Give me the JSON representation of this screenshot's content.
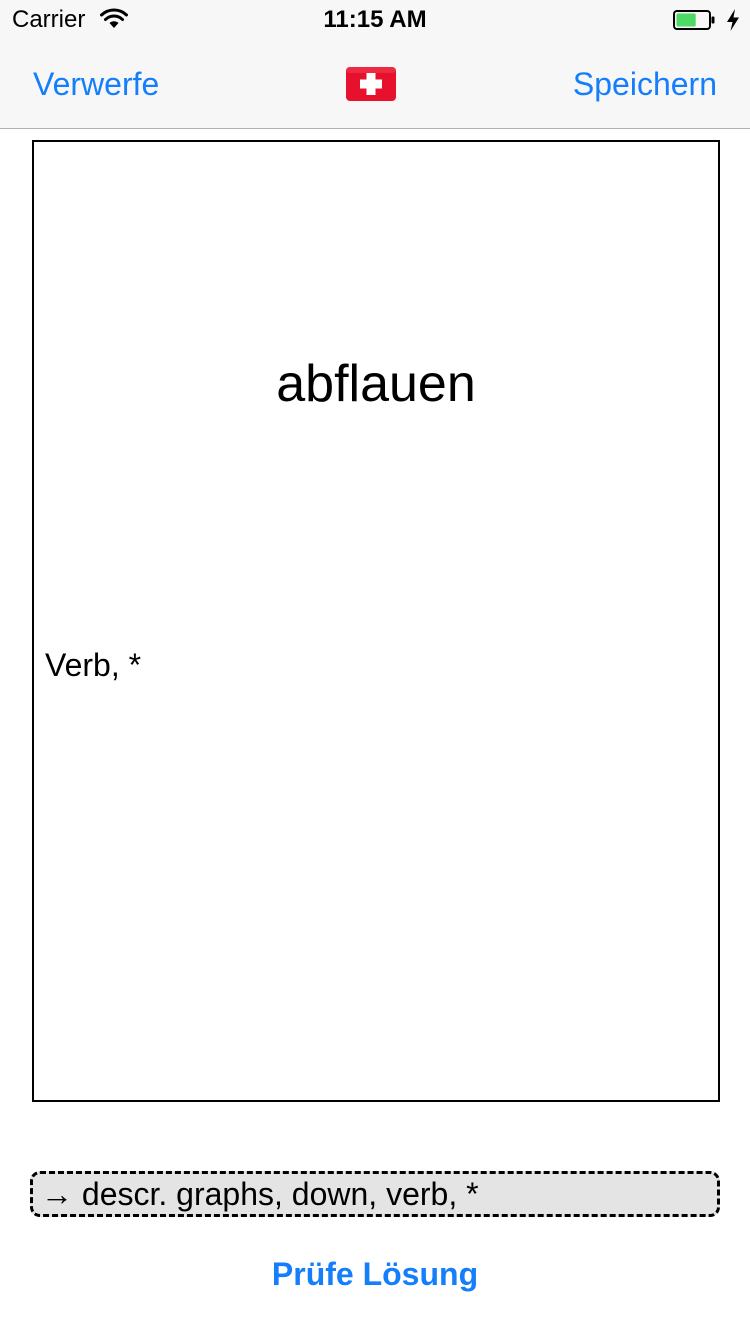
{
  "status_bar": {
    "carrier": "Carrier",
    "time": "11:15 AM",
    "battery_level": 0.62,
    "icons": [
      "wifi-icon",
      "battery-icon",
      "charging-bolt-icon"
    ]
  },
  "nav": {
    "left_label": "Verwerfe",
    "right_label": "Speichern",
    "center_icon": "swiss-flag-icon"
  },
  "card": {
    "word": "abflauen",
    "info": "Verb, *"
  },
  "answer": {
    "value": "→ descr. graphs, down, verb, *"
  },
  "actions": {
    "check_label": "Prüfe Lösung"
  },
  "colors": {
    "accent": "#147efb",
    "bar_background": "#f7f7f7",
    "answer_background": "#e4e4e4",
    "battery_green": "#4cd964",
    "flag_red": "#e8112d"
  }
}
